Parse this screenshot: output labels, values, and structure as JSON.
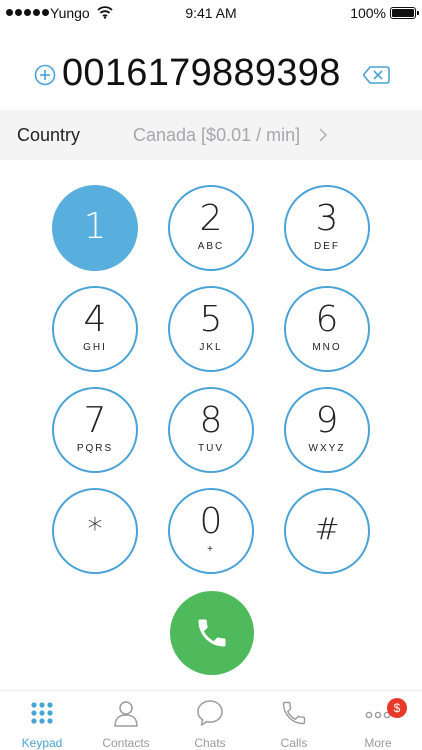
{
  "status_bar": {
    "carrier": "Yungo",
    "time": "9:41 AM",
    "battery": "100%",
    "battery_level": 1.0
  },
  "dialer": {
    "number": "0016179889398",
    "add_icon": "plus-circle-icon",
    "backspace_icon": "backspace-icon"
  },
  "country": {
    "label": "Country",
    "value": "Canada [$0.01 / min]",
    "chevron_icon": "chevron-right-icon"
  },
  "keypad": {
    "keys": [
      {
        "digit": "1",
        "letters": ""
      },
      {
        "digit": "2",
        "letters": "ABC"
      },
      {
        "digit": "3",
        "letters": "DEF"
      },
      {
        "digit": "4",
        "letters": "GHI"
      },
      {
        "digit": "5",
        "letters": "JKL"
      },
      {
        "digit": "6",
        "letters": "MNO"
      },
      {
        "digit": "7",
        "letters": "PQRS"
      },
      {
        "digit": "8",
        "letters": "TUV"
      },
      {
        "digit": "9",
        "letters": "WXYZ"
      },
      {
        "digit": "*",
        "letters": ""
      },
      {
        "digit": "0",
        "letters": "+"
      },
      {
        "digit": "#",
        "letters": ""
      }
    ],
    "active_key": "1"
  },
  "call_button": {
    "icon": "phone-icon"
  },
  "tab_bar": {
    "tabs": [
      {
        "label": "Keypad",
        "icon": "keypad-icon",
        "selected": true
      },
      {
        "label": "Contacts",
        "icon": "person-icon",
        "selected": false
      },
      {
        "label": "Chats",
        "icon": "chat-bubble-icon",
        "selected": false
      },
      {
        "label": "Calls",
        "icon": "phone-outline-icon",
        "selected": false
      },
      {
        "label": "More",
        "icon": "more-dots-icon",
        "selected": false,
        "badge": "$"
      }
    ]
  },
  "colors": {
    "accent": "#4aa3d6",
    "active_key": "#58aedd",
    "call_green": "#4fba5b",
    "badge_red": "#e8392b",
    "muted_text": "#a7a7ab",
    "row_background": "#f4f4f5"
  }
}
